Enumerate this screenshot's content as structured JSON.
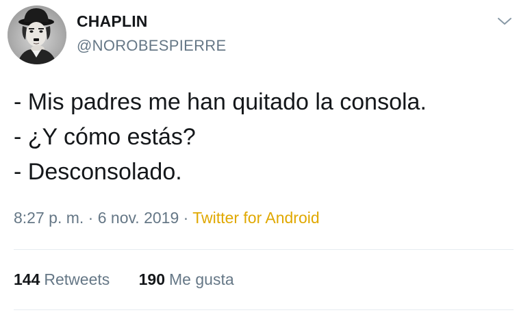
{
  "user": {
    "display_name": "CHAPLIN",
    "handle": "@NOROBESPIERRE",
    "avatar": "chaplin-portrait"
  },
  "header": {
    "menu_icon": "chevron-down-icon"
  },
  "tweet": {
    "lines": [
      "- Mis padres me han quitado la consola.",
      "- ¿Y cómo estás?",
      "- Desconsolado."
    ]
  },
  "meta": {
    "time": "8:27 p. m.",
    "separator1": " · ",
    "date": "6 nov. 2019",
    "separator2": " · ",
    "source": "Twitter for Android"
  },
  "stats": {
    "retweets_count": "144",
    "retweets_label": "Retweets",
    "likes_count": "190",
    "likes_label": "Me gusta"
  },
  "colors": {
    "text": "#14171a",
    "secondary": "#657786",
    "source_link": "#e0a800",
    "divider": "#e6ecf0"
  }
}
